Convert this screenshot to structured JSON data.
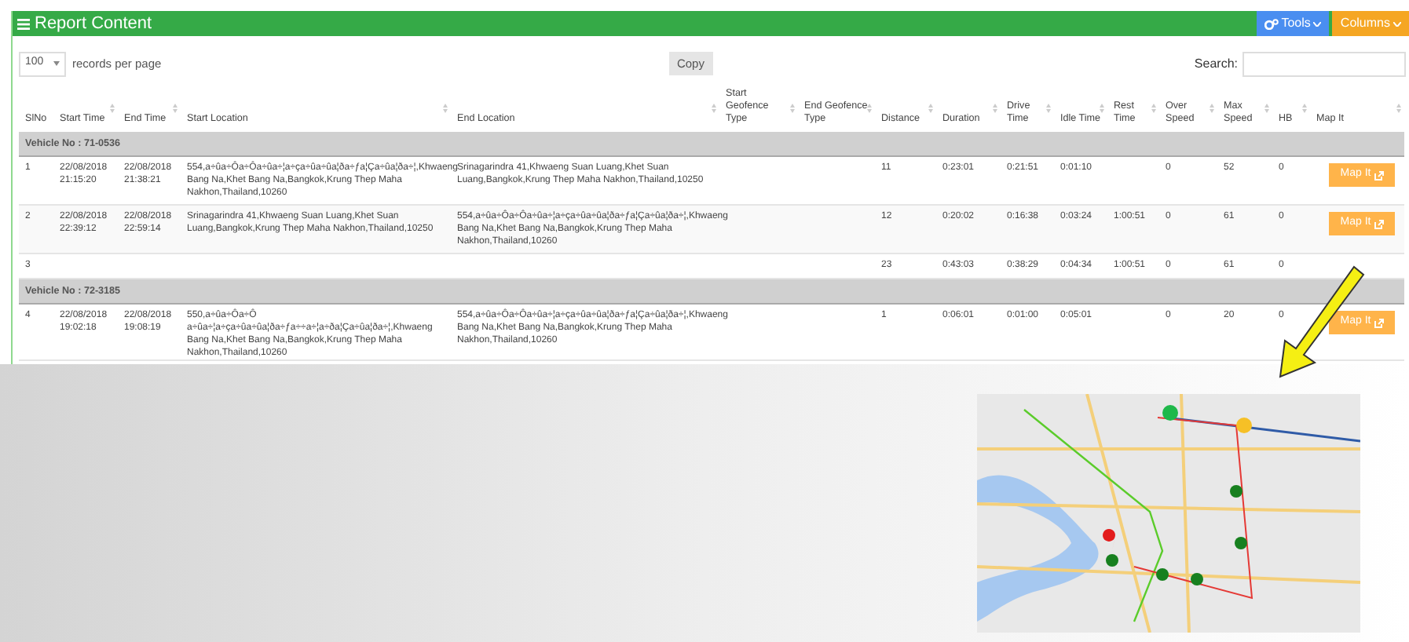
{
  "header": {
    "title": "Report Content",
    "buttons": [
      {
        "label": "Tools",
        "kind": "tools"
      },
      {
        "label": "Columns",
        "kind": "columns"
      }
    ]
  },
  "controls": {
    "page_length": "100",
    "page_length_label": "records per page",
    "copy_button": "Copy",
    "search_label": "Search:"
  },
  "table": {
    "columns": [
      "SlNo",
      "Start Time",
      "End Time",
      "Start Location",
      "End Location",
      "Start Geofence Type",
      "End Geofence Type",
      "Distance",
      "Duration",
      "Drive Time",
      "Idle Time",
      "Rest Time",
      "Over Speed",
      "Max Speed",
      "HB",
      "Map It"
    ],
    "groups": [
      {
        "label": "Vehicle No : 71-0536",
        "rows": [
          {
            "kind": "trip",
            "cells": [
              "1",
              "22/08/2018 21:15:20",
              "22/08/2018 21:38:21",
              "554,a÷ûa÷Ôa÷Ôa÷ûa÷¦a÷ça÷ûa÷ûa¦ða÷ƒa¦Ça÷ûa¦ða÷¦,Khwaeng Bang Na,Khet Bang Na,Bangkok,Krung Thep Maha Nakhon,Thailand,10260",
              "Srinagarindra 41,Khwaeng Suan Luang,Khet Suan Luang,Bangkok,Krung Thep Maha Nakhon,Thailand,10250",
              "",
              "",
              "11",
              "0:23:01",
              "0:21:51",
              "0:01:10",
              "",
              "0",
              "52",
              "0"
            ],
            "map_button": "Map It"
          },
          {
            "kind": "trip",
            "cells": [
              "2",
              "22/08/2018 22:39:12",
              "22/08/2018 22:59:14",
              "Srinagarindra 41,Khwaeng Suan Luang,Khet Suan Luang,Bangkok,Krung Thep Maha Nakhon,Thailand,10250",
              "554,a÷ûa÷Ôa÷Ôa÷ûa÷¦a÷ça÷ûa÷ûa¦ða÷ƒa¦Ça÷ûa¦ða÷¦,Khwaeng Bang Na,Khet Bang Na,Bangkok,Krung Thep Maha Nakhon,Thailand,10260",
              "",
              "",
              "12",
              "0:20:02",
              "0:16:38",
              "0:03:24",
              "1:00:51",
              "0",
              "61",
              "0"
            ],
            "map_button": "Map It"
          },
          {
            "kind": "total",
            "cells": [
              "3",
              "",
              "",
              "",
              "",
              "",
              "",
              "23",
              "0:43:03",
              "0:38:29",
              "0:04:34",
              "1:00:51",
              "0",
              "61",
              "0"
            ]
          }
        ]
      },
      {
        "label": "Vehicle No : 72-3185",
        "rows": [
          {
            "kind": "trip",
            "cells": [
              "4",
              "22/08/2018 19:02:18",
              "22/08/2018 19:08:19",
              "550,a÷ûa÷Ôa÷Ô a÷ûa÷¦a÷ça÷ûa÷ûa¦ða÷ƒa÷÷a÷¦a÷ða¦Ça÷ûa¦ða÷¦,Khwaeng Bang Na,Khet Bang Na,Bangkok,Krung Thep Maha Nakhon,Thailand,10260",
              "554,a÷ûa÷Ôa÷Ôa÷ûa÷¦a÷ça÷ûa÷ûa¦ða÷ƒa¦Ça÷ûa¦ða÷¦,Khwaeng Bang Na,Khet Bang Na,Bangkok,Krung Thep Maha Nakhon,Thailand,10260",
              "",
              "",
              "1",
              "0:06:01",
              "0:01:00",
              "0:05:01",
              "",
              "0",
              "20",
              "0"
            ],
            "map_button": "Map It"
          }
        ]
      }
    ]
  }
}
